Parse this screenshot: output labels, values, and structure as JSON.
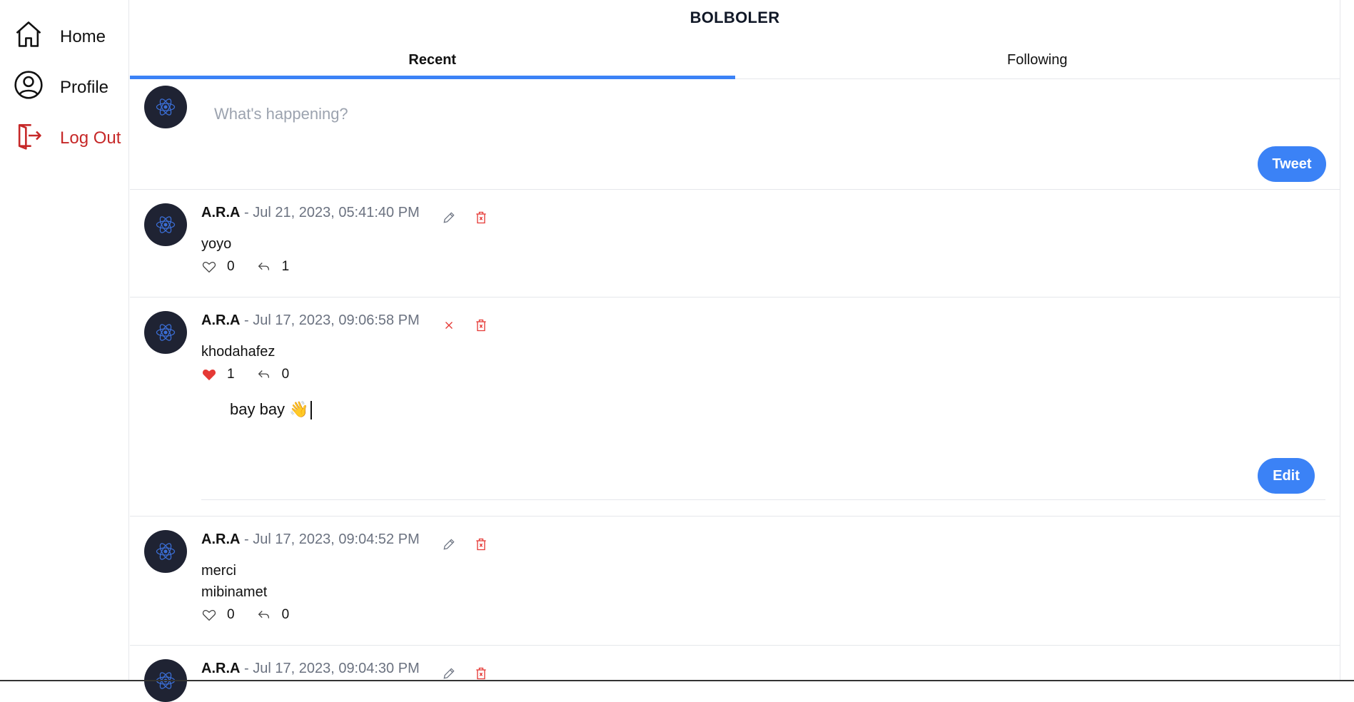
{
  "sidebar": {
    "items": [
      {
        "label": "Home",
        "icon": "home-icon"
      },
      {
        "label": "Profile",
        "icon": "user-circle-icon"
      },
      {
        "label": "Log Out",
        "icon": "logout-icon"
      }
    ]
  },
  "header": {
    "title": "BOLBOLER",
    "tabs": [
      {
        "label": "Recent",
        "active": true
      },
      {
        "label": "Following",
        "active": false
      }
    ]
  },
  "composer": {
    "placeholder": "What's happening?",
    "button_label": "Tweet"
  },
  "colors": {
    "accent": "#3b82f6",
    "danger": "#c62828",
    "avatar_bg": "#1f2333"
  },
  "posts": [
    {
      "author": "A.R.A",
      "meta": " - Jul 21, 2023, 05:41:40 PM",
      "body": "yoyo",
      "likes": "0",
      "replies": "1",
      "liked": false
    },
    {
      "author": "A.R.A",
      "meta": " - Jul 17, 2023, 09:06:58 PM",
      "body": "khodahafez",
      "likes": "1",
      "replies": "0",
      "liked": true,
      "edit_text": "bay bay 👋",
      "edit_button": "Edit"
    },
    {
      "author": "A.R.A",
      "meta": " - Jul 17, 2023, 09:04:52 PM",
      "body": "merci\nmibinamet",
      "likes": "0",
      "replies": "0",
      "liked": false
    },
    {
      "author": "A.R.A",
      "meta": " - Jul 17, 2023, 09:04:30 PM"
    }
  ]
}
